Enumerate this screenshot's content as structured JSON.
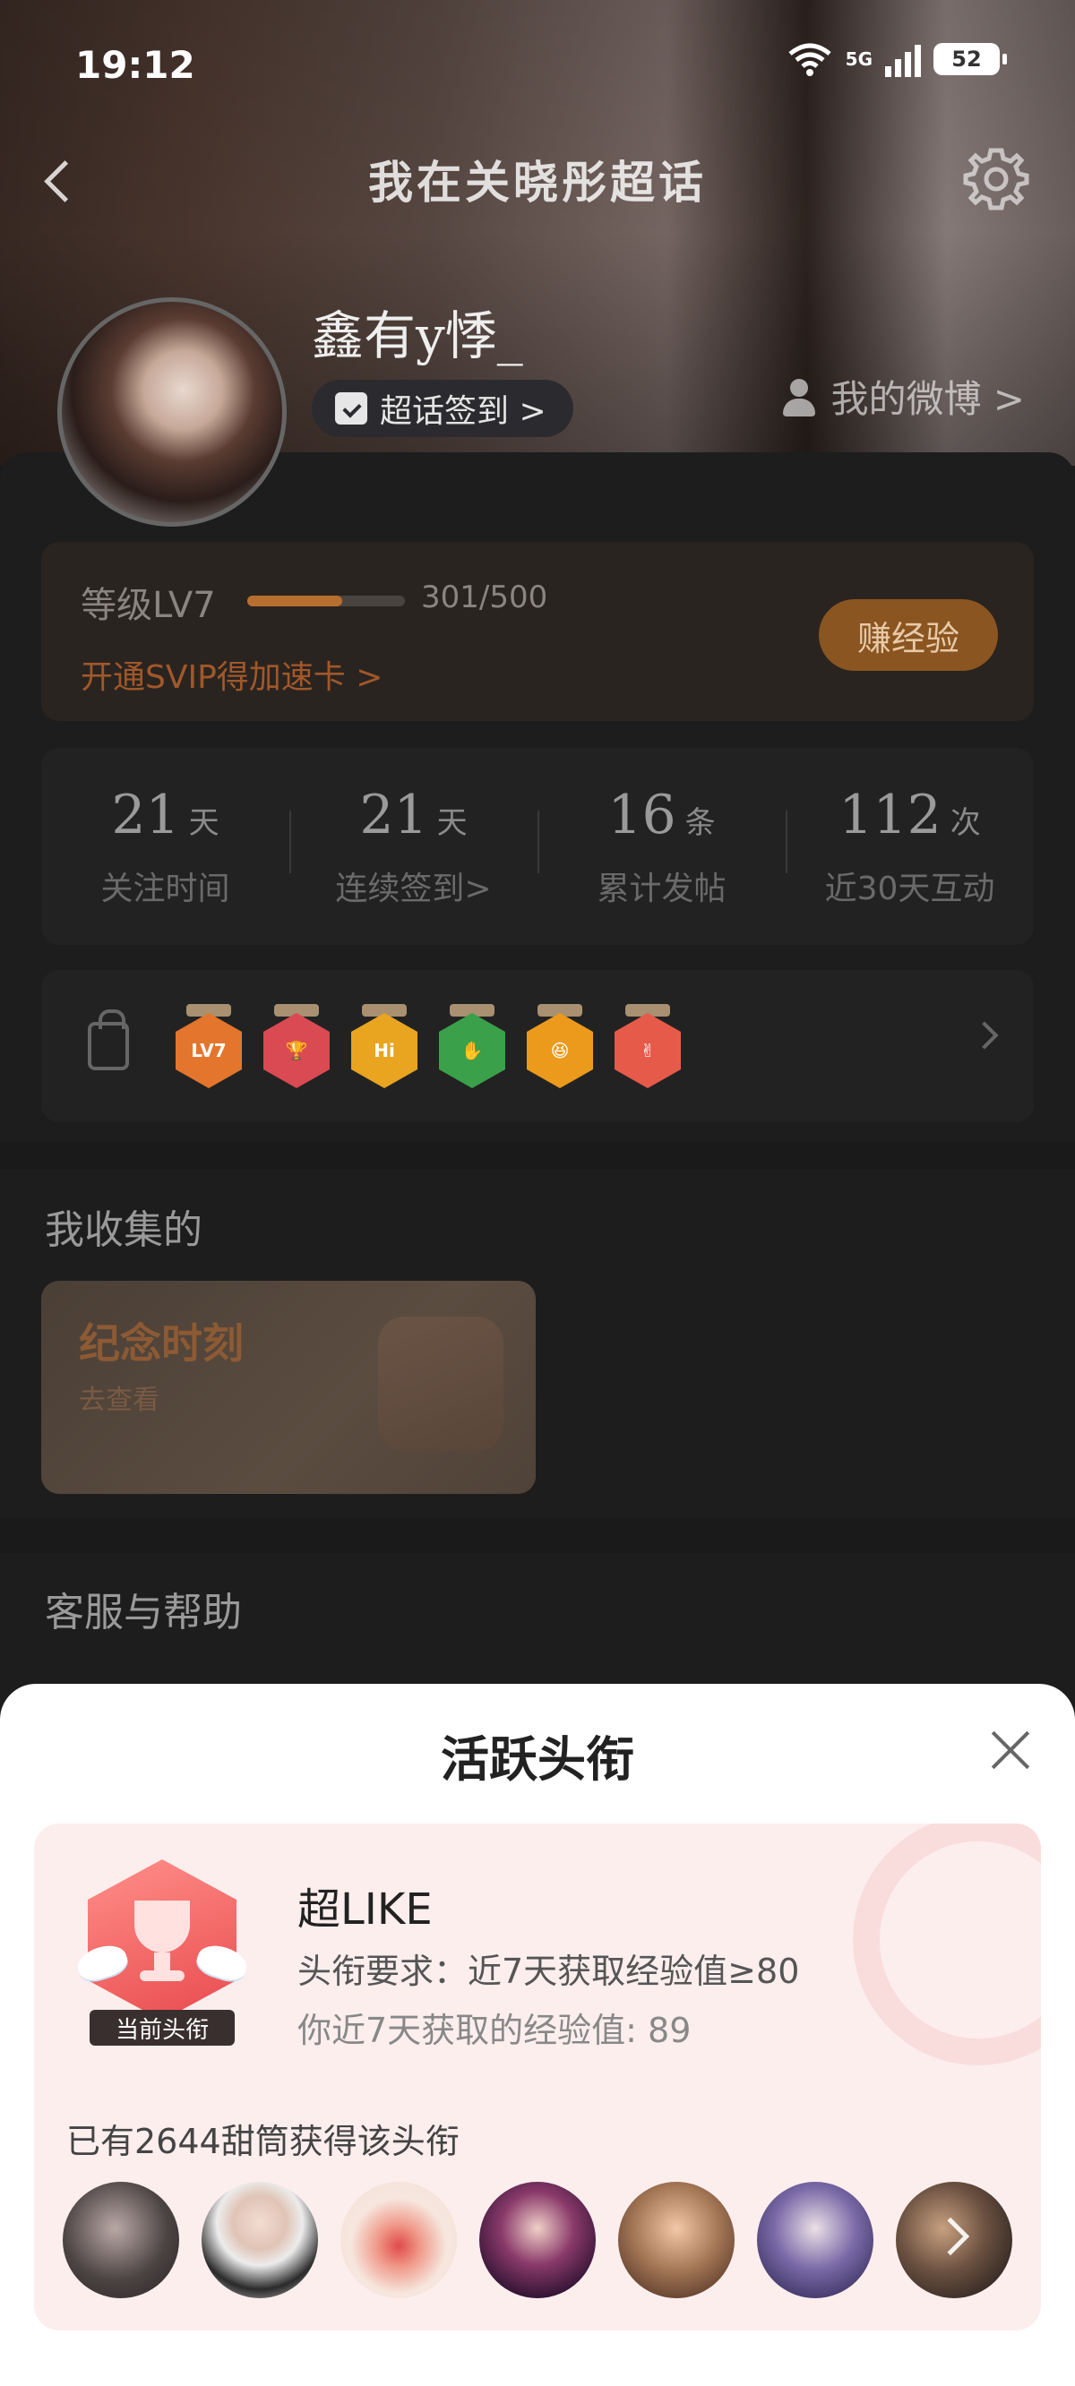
{
  "status_bar": {
    "time": "19:12",
    "network": "5G",
    "battery": "52"
  },
  "nav": {
    "title": "我在关晓彤超话"
  },
  "profile": {
    "username": "鑫有y悸_",
    "checkin_label": "超话签到 >",
    "weibo_link": "我的微博 >"
  },
  "level": {
    "label": "等级LV7",
    "current": 301,
    "max": 500,
    "progress_text": "301/500",
    "progress_fraction": 0.602,
    "svip_text": "开通SVIP得加速卡 >",
    "earn_button": "赚经验"
  },
  "stats": [
    {
      "value": "21",
      "unit": "天",
      "label": "关注时间"
    },
    {
      "value": "21",
      "unit": "天",
      "label": "连续签到>"
    },
    {
      "value": "16",
      "unit": "条",
      "label": "累计发帖"
    },
    {
      "value": "112",
      "unit": "次",
      "label": "近30天互动"
    }
  ],
  "badges": [
    {
      "name": "lv7-badge",
      "text": "LV7",
      "color": "#e3762c"
    },
    {
      "name": "trophy-badge",
      "text": "",
      "color": "#d94a52"
    },
    {
      "name": "hi-badge",
      "text": "Hi",
      "color": "#e9a420"
    },
    {
      "name": "hand-badge",
      "text": "",
      "color": "#3aa04a"
    },
    {
      "name": "emoji-badge",
      "text": "",
      "color": "#eb9a1c"
    },
    {
      "name": "finger-badge",
      "text": "",
      "color": "#e65a4a"
    }
  ],
  "collected": {
    "title": "我收集的",
    "card_title": "纪念时刻",
    "card_sub": "去查看"
  },
  "help": {
    "title": "客服与帮助"
  },
  "sheet": {
    "title": "活跃头衔",
    "badge_tag": "当前头衔",
    "title_name": "超LIKE",
    "requirement": "头衔要求：近7天获取经验值≥80",
    "my_exp": "你近7天获取的经验值: 89",
    "owners_text": "已有2644甜筒获得该头衔"
  },
  "colors": {
    "accent_orange": "#b86e2e",
    "sheet_card_bg": "#fdeeee",
    "trophy_red": "#e94a4d"
  }
}
